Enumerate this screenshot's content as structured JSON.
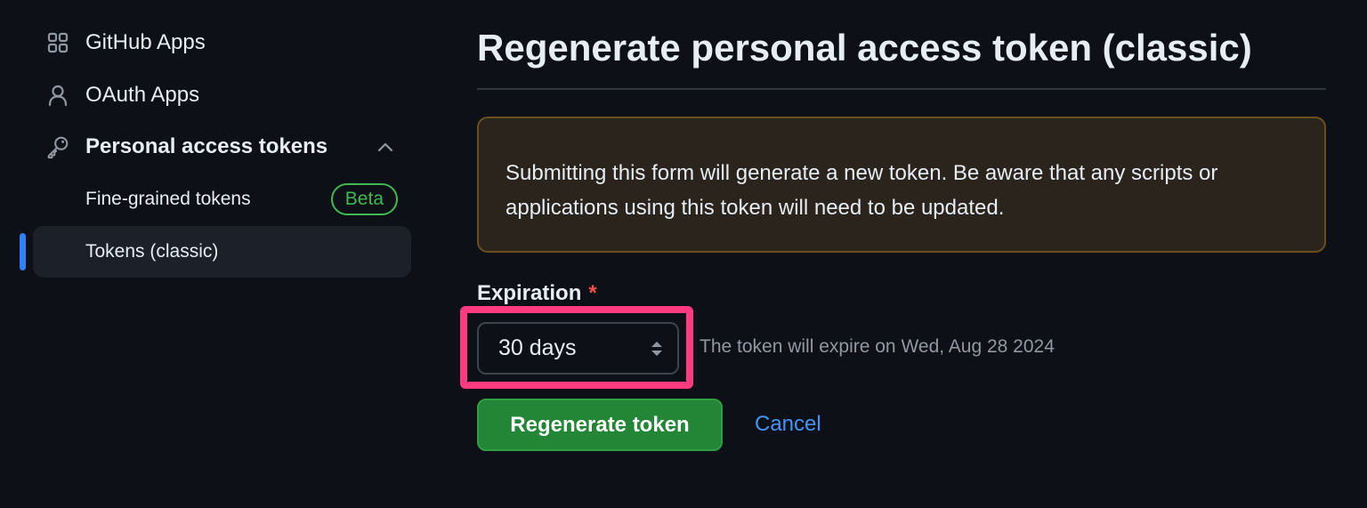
{
  "sidebar": {
    "items": [
      {
        "label": "GitHub Apps",
        "icon": "apps-icon"
      },
      {
        "label": "OAuth Apps",
        "icon": "person-icon"
      },
      {
        "label": "Personal access tokens",
        "icon": "key-icon"
      },
      {
        "label": "Fine-grained tokens",
        "badge": "Beta"
      },
      {
        "label": "Tokens (classic)",
        "active": true
      }
    ]
  },
  "main": {
    "title": "Regenerate personal access token (classic)",
    "flash": "Submitting this form will generate a new token. Be aware that any scripts or applications using this token will need to be updated.",
    "expiration": {
      "label": "Expiration",
      "required_mark": "*",
      "selected": "30 days",
      "note": "The token will expire on Wed, Aug 28 2024"
    },
    "actions": {
      "primary": "Regenerate token",
      "cancel": "Cancel"
    }
  },
  "colors": {
    "background": "#0d1117",
    "accent_blue": "#2f81f7",
    "success_green": "#238636",
    "highlight_pink": "#ff3b7f",
    "warning_bg": "#2a241d"
  }
}
